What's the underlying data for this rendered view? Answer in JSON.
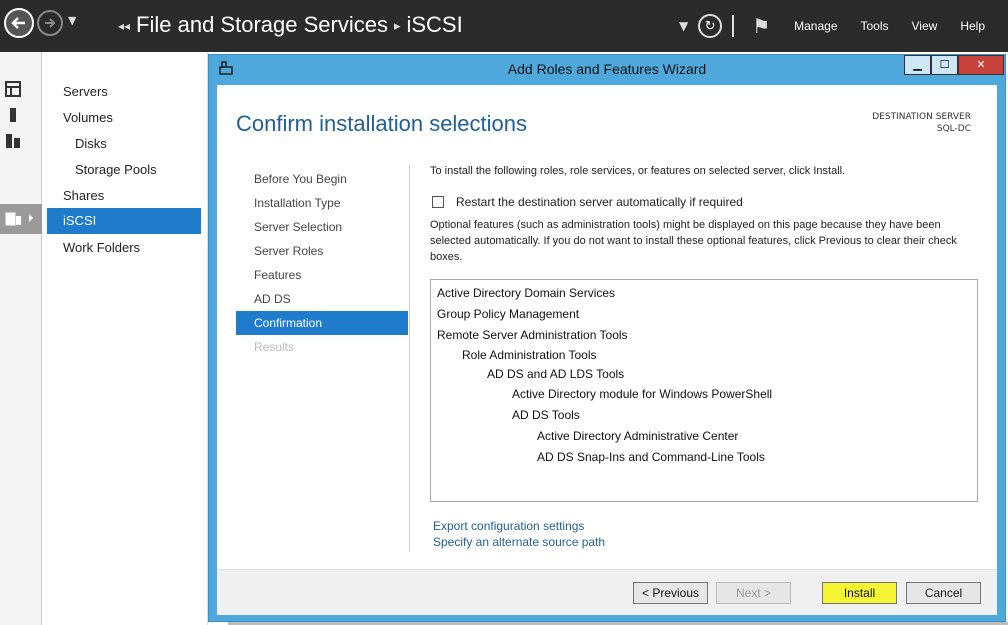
{
  "topbar": {
    "breadcrumb_root": "File and Storage Services",
    "breadcrumb_current": "iSCSI",
    "menu": [
      "Manage",
      "Tools",
      "View",
      "Help"
    ]
  },
  "left_nav": {
    "items": [
      {
        "label": "Servers"
      },
      {
        "label": "Volumes"
      },
      {
        "label": "Disks"
      },
      {
        "label": "Storage Pools"
      },
      {
        "label": "Shares"
      },
      {
        "label": "iSCSI"
      },
      {
        "label": "Work Folders"
      }
    ]
  },
  "wizard": {
    "title": "Add Roles and Features Wizard",
    "heading": "Confirm installation selections",
    "destination_label": "DESTINATION SERVER",
    "destination_value": "SQL-DC",
    "steps": [
      {
        "label": "Before You Begin"
      },
      {
        "label": "Installation Type"
      },
      {
        "label": "Server Selection"
      },
      {
        "label": "Server Roles"
      },
      {
        "label": "Features"
      },
      {
        "label": "AD DS"
      },
      {
        "label": "Confirmation"
      },
      {
        "label": "Results"
      }
    ],
    "intro": "To install the following roles, role services, or features on selected server, click Install.",
    "restart_label": "Restart the destination server automatically if required",
    "optional_text": "Optional features (such as administration tools) might be displayed on this page because they have been selected automatically. If you do not want to install these optional features, click Previous to clear their check boxes.",
    "features": [
      {
        "label": "Active Directory Domain Services"
      },
      {
        "label": "Group Policy Management"
      },
      {
        "label": "Remote Server Administration Tools"
      },
      {
        "label": "Role Administration Tools"
      },
      {
        "label": "AD DS and AD LDS Tools"
      },
      {
        "label": "Active Directory module for Windows PowerShell"
      },
      {
        "label": "AD DS Tools"
      },
      {
        "label": "Active Directory Administrative Center"
      },
      {
        "label": "AD DS Snap-Ins and Command-Line Tools"
      }
    ],
    "links": {
      "export": "Export configuration settings",
      "alternate": "Specify an alternate source path"
    },
    "buttons": {
      "previous": "< Previous",
      "next": "Next >",
      "install": "Install",
      "cancel": "Cancel"
    }
  }
}
